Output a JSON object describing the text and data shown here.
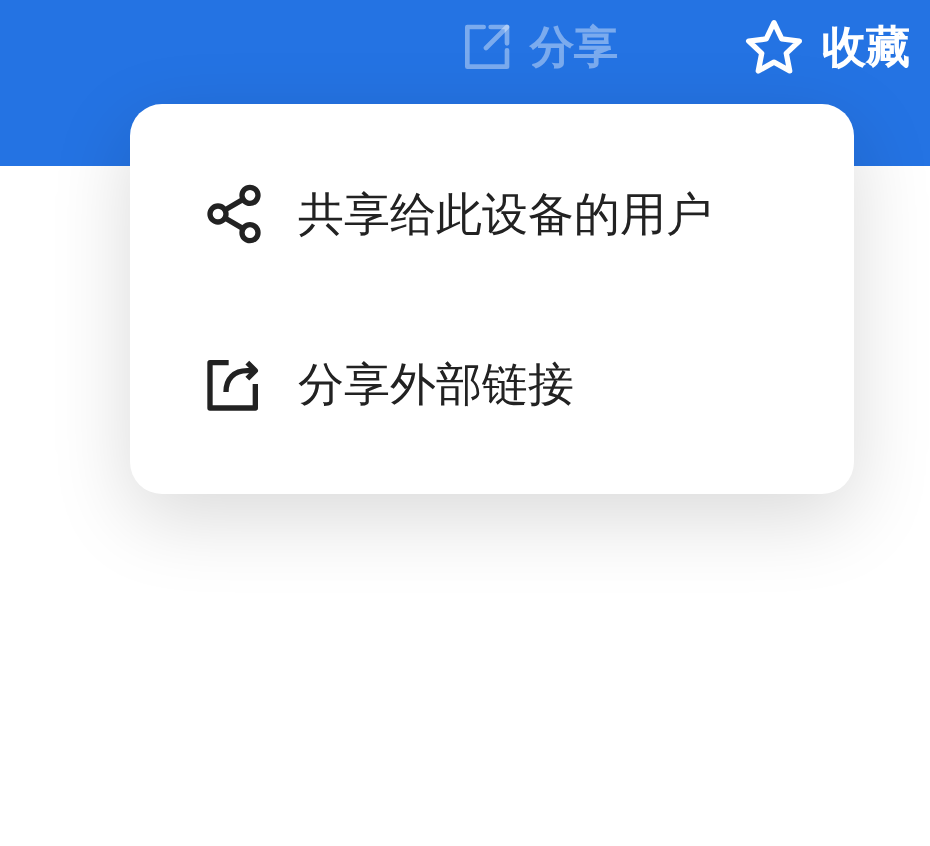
{
  "header": {
    "actions": [
      {
        "kind": "share",
        "label": "分享",
        "dimmed": true
      },
      {
        "kind": "favorite",
        "label": "收藏",
        "dimmed": false
      }
    ]
  },
  "share_menu": {
    "items": [
      {
        "kind": "share",
        "label": "共享给此设备的用户"
      },
      {
        "kind": "export",
        "label": "分享外部链接"
      }
    ]
  }
}
